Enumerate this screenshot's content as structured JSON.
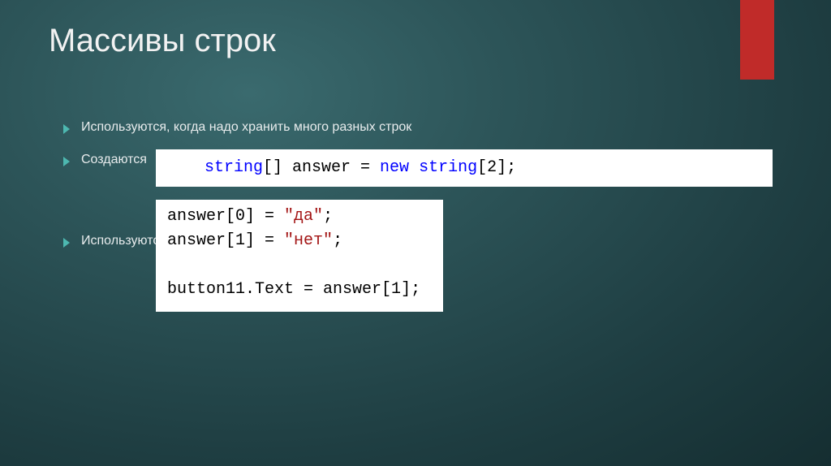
{
  "accent": {
    "color": "#c02b29"
  },
  "title": "Массивы строк",
  "bullets": {
    "b1": "Используются, когда надо хранить много разных строк",
    "b2": "Создаются",
    "b3": "Используются:"
  },
  "code1": {
    "kw1": "string",
    "t1": "[] answer = ",
    "kw2": "new",
    "t2": " ",
    "kw3": "string",
    "t3": "[",
    "num": "2",
    "t4": "];"
  },
  "code2": {
    "l1a": "answer[",
    "l1n": "0",
    "l1b": "] = ",
    "l1s": "\"да\"",
    "l1c": ";",
    "l2a": "answer[",
    "l2n": "1",
    "l2b": "] = ",
    "l2s": "\"нет\"",
    "l2c": ";",
    "l4a": "button11.Text = answer[",
    "l4n": "1",
    "l4b": "];"
  }
}
